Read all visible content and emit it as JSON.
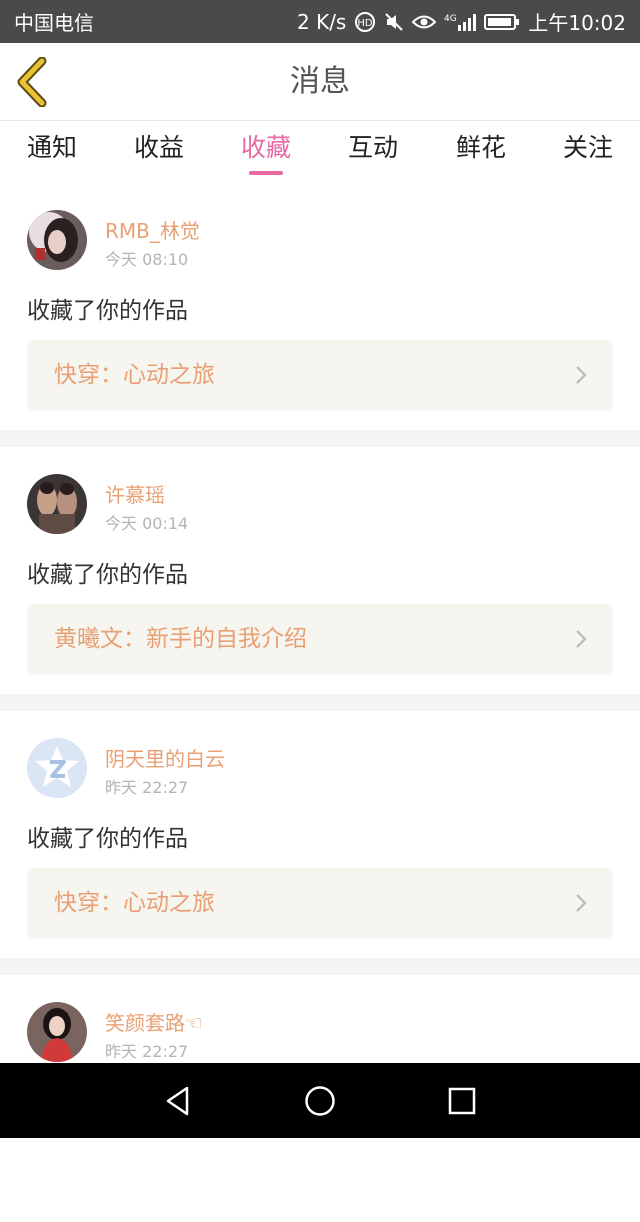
{
  "status_bar": {
    "carrier": "中国电信",
    "speed": "2 K/s",
    "network": "4G",
    "time": "上午10:02"
  },
  "header": {
    "title": "消息",
    "back_icon": "chevron-left-icon",
    "accent": "#e8c238"
  },
  "tabs": [
    {
      "label": "通知",
      "active": false
    },
    {
      "label": "收益",
      "active": false
    },
    {
      "label": "收藏",
      "active": true
    },
    {
      "label": "互动",
      "active": false
    },
    {
      "label": "鲜花",
      "active": false
    },
    {
      "label": "关注",
      "active": false
    }
  ],
  "colors": {
    "active_tab": "#e86aa2",
    "username": "#e8a074",
    "work_title": "#e8a074",
    "work_bg": "#f6f5ef"
  },
  "notifications": [
    {
      "username": "RMB_林觉",
      "time": "今天 08:10",
      "action": "收藏了你的作品",
      "work": "快穿：心动之旅",
      "avatar": "photo-avatar"
    },
    {
      "username": "许慕瑶",
      "time": "今天 00:14",
      "action": "收藏了你的作品",
      "work": "黄曦文：新手的自我介绍",
      "avatar": "photo-avatar"
    },
    {
      "username": "阴天里的白云",
      "time": "昨天 22:27",
      "action": "收藏了你的作品",
      "work": "快穿：心动之旅",
      "avatar": "qq-default-avatar"
    },
    {
      "username": "笑颜套路☜",
      "time": "昨天 22:27",
      "action": "",
      "work": "",
      "avatar": "photo-avatar"
    }
  ],
  "nav": {
    "back": "triangle-back-icon",
    "home": "circle-home-icon",
    "recents": "square-recents-icon"
  }
}
